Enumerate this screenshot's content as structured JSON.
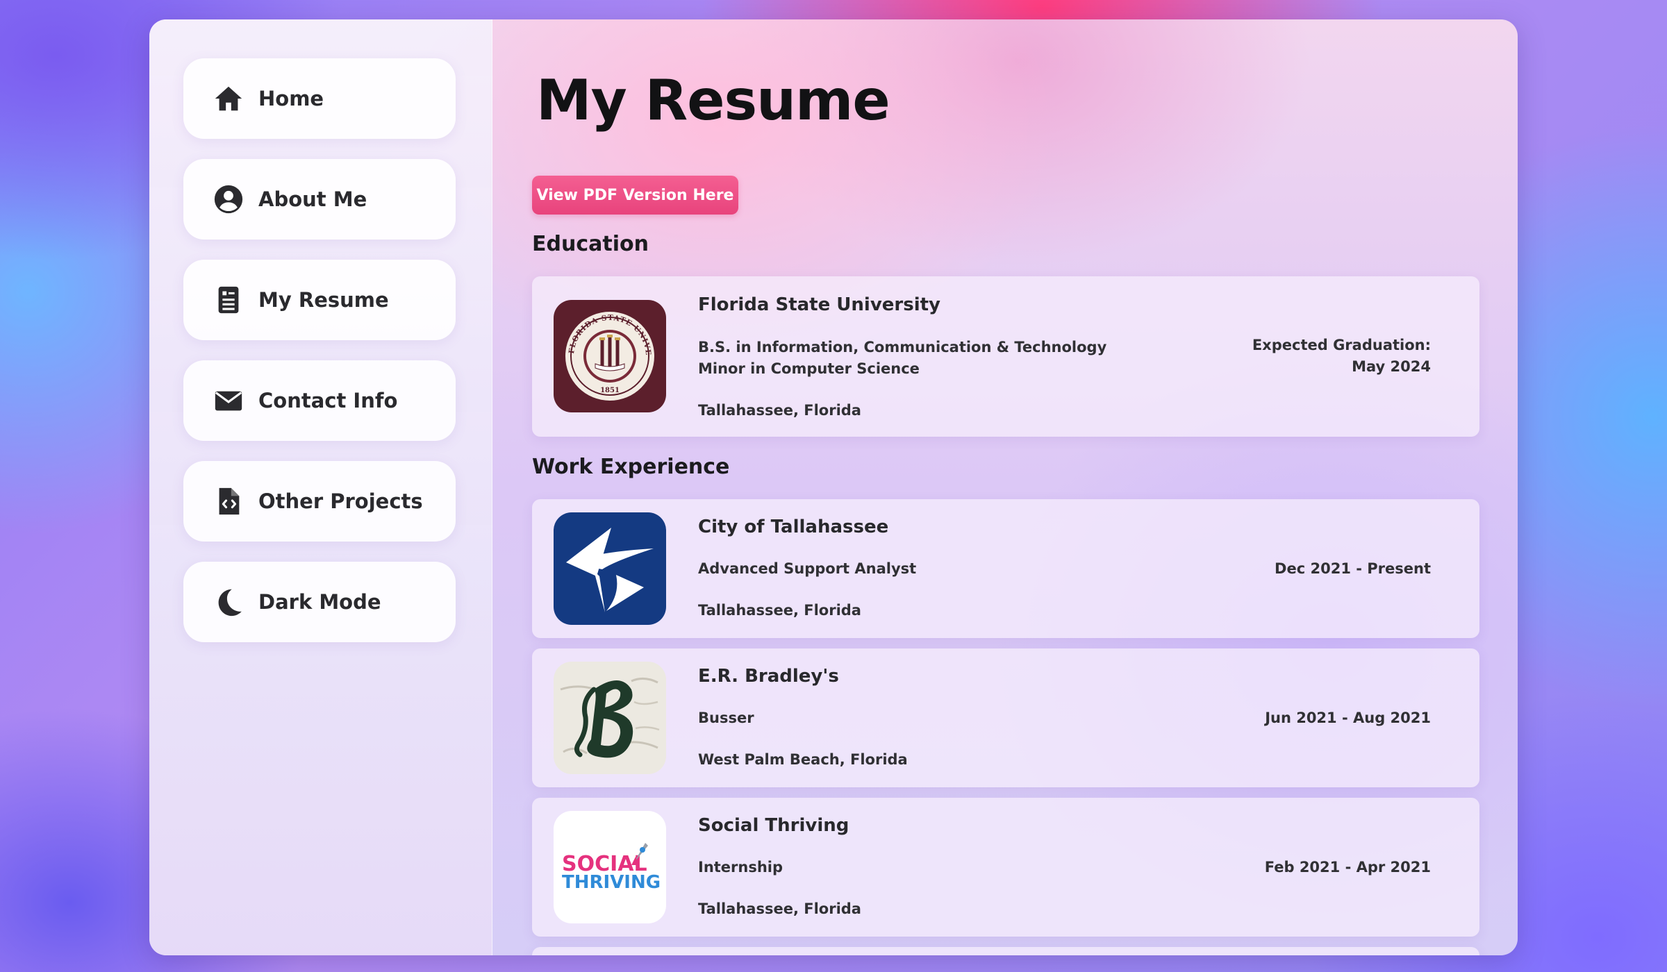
{
  "nav": {
    "items": [
      {
        "label": "Home",
        "icon": "home-icon"
      },
      {
        "label": "About Me",
        "icon": "user-circle-icon"
      },
      {
        "label": "My Resume",
        "icon": "document-icon"
      },
      {
        "label": "Contact Info",
        "icon": "envelope-icon"
      },
      {
        "label": "Other Projects",
        "icon": "code-file-icon"
      },
      {
        "label": "Dark Mode",
        "icon": "moon-icon"
      }
    ]
  },
  "page": {
    "title": "My Resume",
    "pdf_button": "View PDF Version Here"
  },
  "education": {
    "heading": "Education",
    "entries": [
      {
        "school": "Florida State University",
        "degree": "B.S. in Information, Communication & Technology",
        "minor": "Minor in Computer Science",
        "location": "Tallahassee, Florida",
        "date_label": "Expected Graduation:",
        "date": "May 2024",
        "logo": "fsu-seal-logo",
        "logo_text": "FLORIDA STATE UNIVERSITY",
        "logo_year": "1851"
      }
    ]
  },
  "work": {
    "heading": "Work Experience",
    "entries": [
      {
        "company": "City of Tallahassee",
        "role": "Advanced Support Analyst",
        "location": "Tallahassee, Florida",
        "dates": "Dec 2021 - Present",
        "logo": "city-of-tallahassee-logo"
      },
      {
        "company": "E.R. Bradley's",
        "role": "Busser",
        "location": "West Palm Beach, Florida",
        "dates": "Jun 2021 - Aug 2021",
        "logo": "er-bradleys-logo"
      },
      {
        "company": "Social Thriving",
        "role": "Internship",
        "location": "Tallahassee, Florida",
        "dates": "Feb 2021 - Apr 2021",
        "logo": "social-thriving-logo",
        "logo_text_top": "SOCIAL",
        "logo_text_bottom": "THRIVING"
      }
    ]
  },
  "colors": {
    "accent": "#e8437c",
    "fsu_garnet": "#5c1f2c",
    "city_blue": "#143a82",
    "bradleys_green": "#1f3a2a"
  }
}
